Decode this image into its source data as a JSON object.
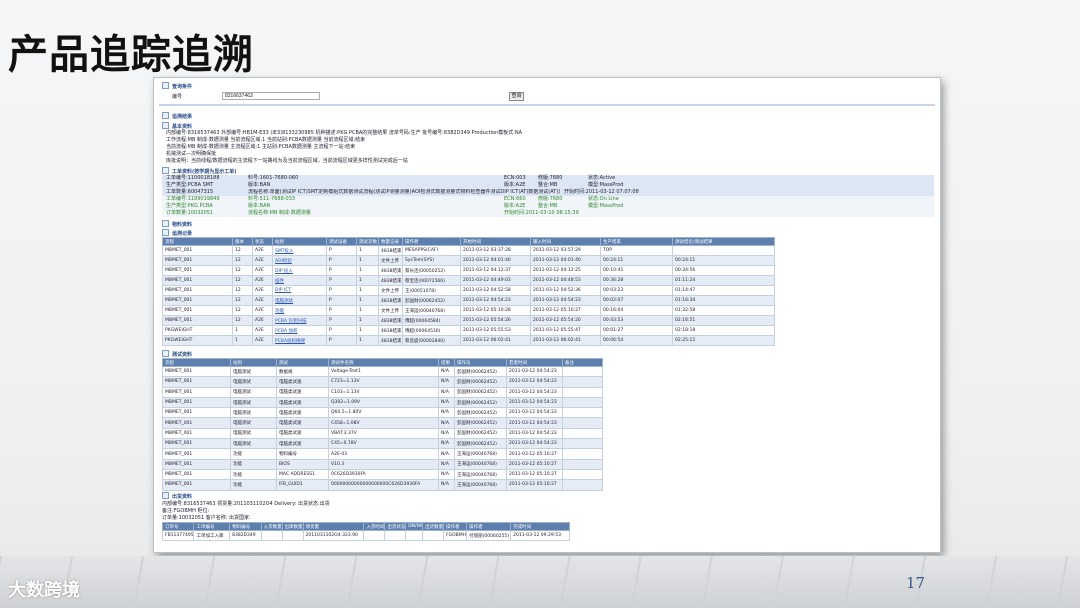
{
  "slide": {
    "title": "产品追踪追溯",
    "logo_text": "大数跨境",
    "page_number": "17"
  },
  "query": {
    "section_title": "查询条件",
    "label": "编号",
    "value": "8316637463",
    "button": "查询"
  },
  "result_title": "追溯结果",
  "basic": {
    "title": "基本资料",
    "lines": [
      "内部编号:8316537463    外部编号:HB1M-E33 (IE3)8133230985    机种描述:PKG PCBA的完整结果    流单号码:生产    批号编号:8382D349    Production模板式:NA",
      "工作流程:MB 制成-数据测量    当前流程区域:1    当前站别:PCBA数据测量    当前流程区域:结束",
      "当前流程:MB 制成-数据测量    主流程区域:1    主站别:PCBA数据测量    主流程下一站:结束",
      "机械测试—次明确保批",
      "库批说明：当前线程/数据流程的主流程下一站路线为及当前流程区域，当前流程区域更多样性测试完成后一站"
    ]
  },
  "order": {
    "title": "工单资料(按学期为显示工单)",
    "rows": [
      [
        "工单编号:1100018188",
        "料号:1601-7680-060",
        "ECN:003",
        "修版:7680",
        "状态:Active"
      ],
      [
        "生产类型:PCBA SMT",
        "版本:BAN",
        "版本:A2E",
        "整合:MB",
        "模型:MassProd"
      ],
      [
        "工单数量:60047315",
        "流程名称:单面(测试IP ICT)SMT定制模组式数据测试流程(测试IP测量测量)AOI检测式数据测量式物料检查器件测试DIP ICT(AT)数据测试(AT)式数据测量PK-VI式全分析",
        "",
        "",
        "开始时间:2011-03-12 07:07:08"
      ]
    ],
    "green_rows": [
      [
        "工单编号:1199019849",
        "料号:511-7688-033",
        "ECN:660",
        "修版:7680",
        "状态:On Line"
      ],
      [
        "生产类型:PKG PCBA",
        "版本:BAN",
        "版本:A2E",
        "整合:MB",
        "模型:MassProd"
      ],
      [
        "订单数量:10032051",
        "流程名称:MB 制成-数据测量",
        "开始时间:2011-03-10 08:15:39",
        "",
        ""
      ]
    ]
  },
  "pipe": {
    "title": "物料资料",
    "subtitle": "追溯记录",
    "headers": [
      "流程",
      "版本",
      "状态",
      "站别",
      "测试设备",
      "测试次数",
      "数量记录",
      "操作者",
      "开始时间",
      "输入时间",
      "生产结束",
      "测试结论/测试结果"
    ],
    "rows": [
      [
        "MBMET_001",
        "12",
        "A2E",
        "SMT投入",
        "P",
        "1",
        "4838结束",
        "MESAPPS(CAF)",
        "2011-03-12 03:37:28",
        "2011-03-12 03:57:29",
        "TOP",
        ""
      ],
      [
        "MBMET_001",
        "12",
        "A2E",
        "AOI检验",
        "P",
        "1",
        "文件上传",
        "SysTem(SYS)",
        "2011-03-12 04:01:40",
        "2011-03-12 04:01:40",
        "00:24:11",
        "00:24:11"
      ],
      [
        "MBMET_001",
        "12",
        "A2E",
        "DIP 投入",
        "P",
        "1",
        "4838结束",
        "蔡长连(00050252)",
        "2011-03-12 04:12:37",
        "2011-03-12 04:12:25",
        "00:10:45",
        "00:34:56"
      ],
      [
        "MBMET_001",
        "12",
        "A2E",
        "插件",
        "P",
        "1",
        "4838结束",
        "蔡宝连(00072566)",
        "2011-03-12 04:49:03",
        "2011-03-12 04:48:53",
        "00:36:28",
        "01:11:24"
      ],
      [
        "MBMET_001",
        "12",
        "A2E",
        "DIP ICT",
        "P",
        "1",
        "文件上传",
        "王(00051078)",
        "2011-03-12 04:52:58",
        "2011-03-12 04:52:36",
        "00:03:23",
        "01:14:47"
      ],
      [
        "MBMET_001",
        "12",
        "A2E",
        "电脑测试",
        "P",
        "1",
        "4838结束",
        "彭国财(00062452)",
        "2011-03-12 04:54:23",
        "2011-03-12 04:54:23",
        "00:02:07",
        "01:16:34"
      ],
      [
        "MBMET_001",
        "12",
        "A2E",
        "功能",
        "P",
        "1",
        "文件上传",
        "王海运(00040768)",
        "2011-03-12 05:10:28",
        "2011-03-12 05:10:27",
        "00:16:04",
        "01:32:58"
      ],
      [
        "MBMET_001",
        "12",
        "A2E",
        "PCBA 包装扫描",
        "P",
        "1",
        "4838结束",
        "傅超(00064584)",
        "2011-03-12 05:54:26",
        "2011-03-12 05:54:20",
        "00:43:53",
        "02:16:51"
      ],
      [
        "PKGWEIGHT",
        "1",
        "A2E",
        "PCBA 加权",
        "P",
        "1",
        "4838结束",
        "傅超(00064530)",
        "2011-03-12 05:55:53",
        "2011-03-12 05:55:47",
        "00:01:27",
        "02:18:18"
      ],
      [
        "PKGWEIGHT",
        "1",
        "A2E",
        "PCBA加权确保",
        "P",
        "1",
        "4838结束",
        "蔡昌盛(00002840)",
        "2011-03-12 06:02:41",
        "2011-03-12 06:02:41",
        "00:06:54",
        "02:25:12"
      ]
    ]
  },
  "test": {
    "title": "测试资料",
    "headers": [
      "流程",
      "站别",
      "测试",
      "测试件名称",
      "结果",
      "操作员",
      "若者时间",
      "备注"
    ],
    "rows": [
      [
        "MBMET_001",
        "电脑测试",
        "数据规",
        "Voltage-Test1",
        "N/A",
        "彭国财(00062452)",
        "2011-03-12 04:54:23",
        ""
      ],
      [
        "MBMET_001",
        "电脑测试",
        "电脑类试速",
        "C723=1.13V",
        "N/A",
        "彭国财(00062452)",
        "2011-03-12 04:54:23",
        ""
      ],
      [
        "MBMET_001",
        "电脑测试",
        "电脑类试速",
        "C103=1.13V",
        "N/A",
        "彭国财(00062452)",
        "2011-03-12 04:54:23",
        ""
      ],
      [
        "MBMET_001",
        "电脑测试",
        "电脑类试速",
        "Q392=1.09V",
        "N/A",
        "彭国财(00062452)",
        "2011-03-12 04:54:23",
        ""
      ],
      [
        "MBMET_001",
        "电脑测试",
        "电脑类试速",
        "Q60.5=1.80V",
        "N/A",
        "彭国财(00062452)",
        "2011-03-12 04:54:23",
        ""
      ],
      [
        "MBMET_001",
        "电脑测试",
        "电脑类试速",
        "C458=1.08V",
        "N/A",
        "彭国财(00062452)",
        "2011-03-12 04:54:23",
        ""
      ],
      [
        "MBMET_001",
        "电脑测试",
        "电脑类试速",
        "VBAT:3.37V",
        "N/A",
        "彭国财(00062452)",
        "2011-03-12 04:54:23",
        ""
      ],
      [
        "MBMET_001",
        "电脑测试",
        "电脑类试速",
        "C45=0.78V",
        "N/A",
        "彭国财(00062452)",
        "2011-03-12 04:54:23",
        ""
      ],
      [
        "MBMET_001",
        "功能",
        "物料编号",
        "A2E-03",
        "N/A",
        "王海运(00040768)",
        "2011-03-12 05:10:27",
        ""
      ],
      [
        "MBMET_001",
        "功能",
        "BIOS",
        "V10.3",
        "N/A",
        "王海运(00040768)",
        "2011-03-12 05:10:27",
        ""
      ],
      [
        "MBMET_001",
        "功能",
        "MAC ADDRESS1",
        "0C626D3930FA",
        "N/A",
        "王海运(00040768)",
        "2011-03-12 05:10:27",
        ""
      ],
      [
        "MBMET_001",
        "功能",
        "IFB_GUID1",
        "00000000000000000000C626D3930FA",
        "N/A",
        "王海运(00040768)",
        "2011-03-12 05:10:27",
        ""
      ]
    ]
  },
  "shipping": {
    "title": "出货资料",
    "lines": [
      "内部编号:8316537463    领货量:2011031102O4    Delivery:    出货状态:出货",
      "备注:FGOBMH    柜位:",
      "订单量:10032051    客户名称:    出货国家:"
    ],
    "headers": [
      "订单号",
      "工单编号",
      "物料编号",
      "入货数量",
      "出库数量",
      "领货量",
      "入货时间",
      "出货状态",
      "DN/WO",
      "出货数量",
      "操作者",
      "操作者",
      "完成时间"
    ],
    "rows": [
      [
        "FB113774952",
        "工单加工入库",
        "8382D349",
        "",
        "",
        "2011031102O4:323.90",
        "",
        "",
        "",
        "",
        "FGOBMH",
        "付丽丽(00060255)",
        "2011-03-12 09:29:53"
      ]
    ]
  }
}
